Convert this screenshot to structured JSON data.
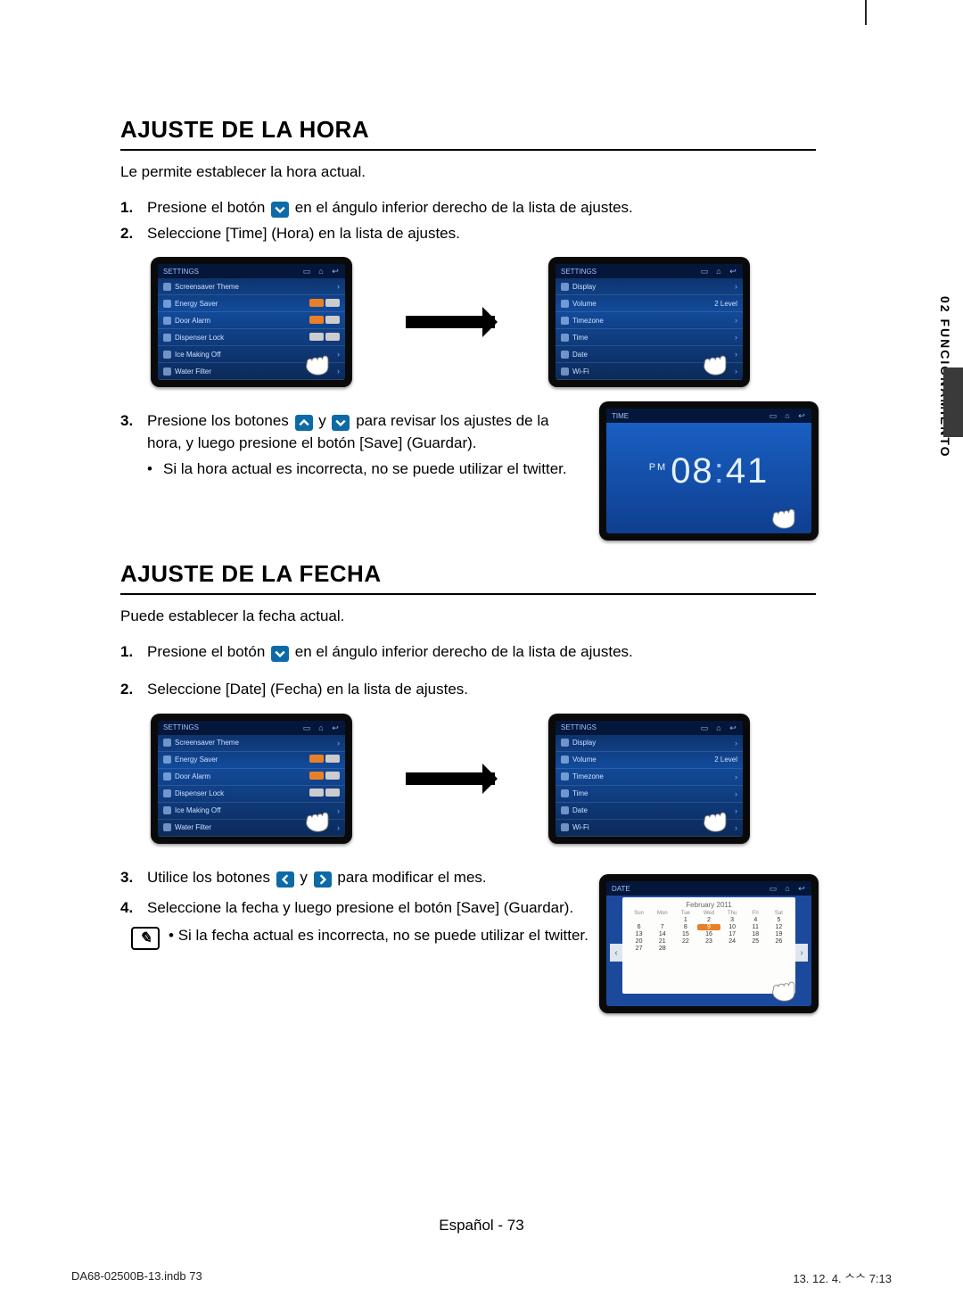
{
  "sidebar": {
    "label": "02  FUNCIONAMIENTO"
  },
  "hora": {
    "title": "AJUSTE DE LA HORA",
    "lead": "Le permite establecer la hora actual.",
    "s1a": "Presione el botón ",
    "s1b": " en el ángulo inferior derecho de la lista de ajustes.",
    "s2": "Seleccione [Time] (Hora) en la lista de ajustes.",
    "s3a": "Presione los botones ",
    "s3y": " y ",
    "s3b": " para revisar los ajustes de la hora, y luego presione el botón [Save] (Guardar).",
    "note": "Si la hora actual es incorrecta, no se puede utilizar el twitter.",
    "time": {
      "pm": "PM",
      "hh": "08",
      "mm": "41",
      "header": "TIME"
    }
  },
  "fecha": {
    "title": "AJUSTE DE LA FECHA",
    "lead": "Puede establecer la fecha actual.",
    "s1a": "Presione el botón ",
    "s1b": " en el ángulo inferior derecho de la lista de ajustes.",
    "s2": "Seleccione [Date] (Fecha) en la lista de ajustes.",
    "s3a": "Utilice los botones ",
    "s3y": " y ",
    "s3b": " para modificar el mes.",
    "s4": "Seleccione la fecha y luego presione el botón [Save] (Guardar).",
    "note": "Si la fecha actual es incorrecta, no se puede utilizar el twitter.",
    "cal": {
      "header": "DATE",
      "month": "February 2011",
      "dow": [
        "Sun",
        "Mon",
        "Tue",
        "Wed",
        "Thu",
        "Fri",
        "Sat"
      ],
      "days": [
        "",
        "",
        "1",
        "2",
        "3",
        "4",
        "5",
        "6",
        "7",
        "8",
        "9",
        "10",
        "11",
        "12",
        "13",
        "14",
        "15",
        "16",
        "17",
        "18",
        "19",
        "20",
        "21",
        "22",
        "23",
        "24",
        "25",
        "26",
        "27",
        "28",
        "",
        "",
        "",
        "",
        ""
      ],
      "selected": "9"
    }
  },
  "settingsA": {
    "title": "SETTINGS",
    "rows": [
      "Screensaver Theme",
      "Energy Saver",
      "Door Alarm",
      "Dispenser Lock",
      "Ice Making Off",
      "Water Filter"
    ]
  },
  "settingsB": {
    "title": "SETTINGS",
    "rows": [
      "Display",
      "Volume",
      "Timezone",
      "Time",
      "Date",
      "Wi-Fi"
    ],
    "volval": "2 Level"
  },
  "n1": "1.",
  "n2": "2.",
  "n3": "3.",
  "n4": "4.",
  "footer": "Español - 73",
  "meta": {
    "left": "DA68-02500B-13.indb   73",
    "right": "13. 12. 4.   ᄉᄉ 7:13"
  }
}
